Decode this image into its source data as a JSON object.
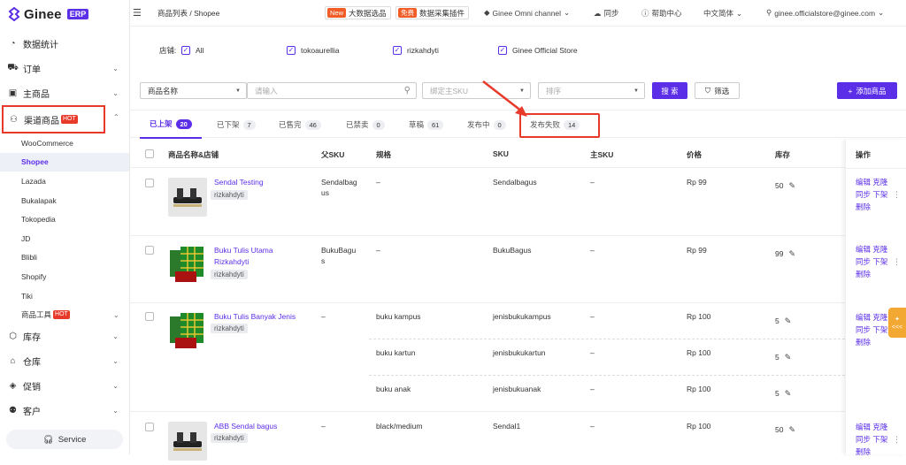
{
  "app": {
    "logo_text": "Ginee",
    "logo_badge": "ERP"
  },
  "sidebar": {
    "items": [
      {
        "label": "数据统计",
        "icon": "dashboard-icon"
      },
      {
        "label": "订单",
        "icon": "cart-icon",
        "expandable": true
      },
      {
        "label": "主商品",
        "icon": "box-icon",
        "expandable": true
      },
      {
        "label": "渠道商品",
        "icon": "channel-icon",
        "badge": "HOT",
        "expanded": true
      }
    ],
    "sub_items": [
      "WooCommerce",
      "Shopee",
      "Lazada",
      "Bukalapak",
      "Tokopedia",
      "JD",
      "Blibli",
      "Shopify",
      "Tiki"
    ],
    "tools": {
      "label": "商品工具",
      "badge": "HOT"
    },
    "more": [
      {
        "label": "库存",
        "icon": "inventory-icon"
      },
      {
        "label": "仓库",
        "icon": "warehouse-icon"
      },
      {
        "label": "促销",
        "icon": "tag-icon"
      },
      {
        "label": "客户",
        "icon": "users-icon"
      }
    ],
    "service_label": "Service"
  },
  "topbar": {
    "breadcrumb": "商品列表 / Shopee",
    "bigdata": {
      "badge": "New",
      "label": "大数据选品"
    },
    "plugin": {
      "badge": "免费",
      "label": "数据采集插件"
    },
    "channel": "Ginee Omni channel",
    "sync": "同步",
    "help": "帮助中心",
    "lang": "中文简体",
    "user": "ginee.officialstore@ginee.com"
  },
  "filter": {
    "label": "店铺:",
    "stores": [
      "All",
      "tokoaurellia",
      "rizkahdyti",
      "Ginee Official Store"
    ]
  },
  "search": {
    "field_select": "商品名称",
    "input_placeholder": "请输入",
    "sku_placeholder": "绑定主SKU",
    "sort_placeholder": "排序",
    "search_btn": "搜 索",
    "filter_btn": "筛选",
    "add_btn": "添加商品"
  },
  "tabs": [
    {
      "label": "已上架",
      "count": "20"
    },
    {
      "label": "已下架",
      "count": "7"
    },
    {
      "label": "已售完",
      "count": "46"
    },
    {
      "label": "已禁卖",
      "count": "0"
    },
    {
      "label": "草稿",
      "count": "61"
    },
    {
      "label": "发布中",
      "count": "0"
    },
    {
      "label": "发布失败",
      "count": "14"
    }
  ],
  "table": {
    "headers": [
      "商品名称&店铺",
      "父SKU",
      "规格",
      "SKU",
      "主SKU",
      "价格",
      "库存",
      "操作"
    ],
    "rows": [
      {
        "name": "Sendal Testing",
        "store": "rizkahdyti",
        "parent_sku": "Sendalbagus",
        "variants": [
          {
            "spec": "–",
            "sku": "Sendalbagus",
            "master": "–",
            "price": "Rp 99",
            "stock": "50"
          }
        ],
        "ops": [
          "编辑 克隆",
          "同步 下架",
          "删除"
        ]
      },
      {
        "name": "Buku Tulis Utama Rizkahdyti",
        "store": "rizkahdyti",
        "parent_sku": "BukuBagus",
        "variants": [
          {
            "spec": "–",
            "sku": "BukuBagus",
            "master": "–",
            "price": "Rp 99",
            "stock": "99"
          }
        ],
        "ops": [
          "编辑 克隆",
          "同步 下架",
          "删除"
        ]
      },
      {
        "name": "Buku Tulis Banyak Jenis",
        "store": "rizkahdyti",
        "parent_sku": "–",
        "variants": [
          {
            "spec": "buku kampus",
            "sku": "jenisbukukampus",
            "master": "–",
            "price": "Rp 100",
            "stock": "5"
          },
          {
            "spec": "buku kartun",
            "sku": "jenisbukukartun",
            "master": "–",
            "price": "Rp 100",
            "stock": "5"
          },
          {
            "spec": "buku anak",
            "sku": "jenisbukuanak",
            "master": "–",
            "price": "Rp 100",
            "stock": "5"
          }
        ],
        "ops": [
          "编辑 克隆",
          "同步 下架",
          "删除"
        ]
      },
      {
        "name": "ABB Sendal bagus",
        "store": "rizkahdyti",
        "parent_sku": "–",
        "variants": [
          {
            "spec": "black/medium",
            "sku": "Sendal1",
            "master": "–",
            "price": "Rp 100",
            "stock": "50"
          }
        ],
        "ops": [
          "编辑 克隆",
          "同步 下架",
          "删除"
        ]
      }
    ]
  },
  "side_tab": "<<<"
}
